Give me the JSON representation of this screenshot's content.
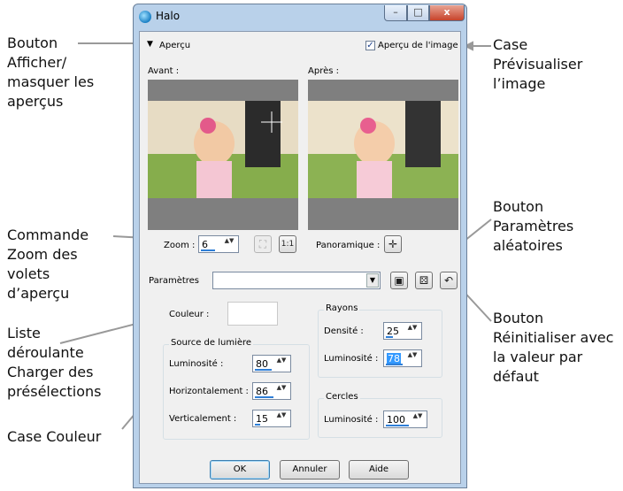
{
  "window": {
    "title": "Halo",
    "minimize": "–",
    "maximize": "□",
    "close": "x"
  },
  "preview_header": {
    "toggle_arrow": "▼",
    "label": "Aperçu",
    "preview_image_label": "Aperçu de l'image",
    "preview_image_checked": true
  },
  "panes": {
    "before_label": "Avant :",
    "after_label": "Après :"
  },
  "zoom": {
    "label": "Zoom :",
    "value": "6",
    "pan_label": "Panoramique :"
  },
  "settings": {
    "label": "Paramètres",
    "preset_value": ""
  },
  "color": {
    "label": "Couleur :"
  },
  "light_source": {
    "title": "Source de lumière",
    "brightness_label": "Luminosité :",
    "brightness_value": "80",
    "horizontal_label": "Horizontalement :",
    "horizontal_value": "86",
    "vertical_label": "Verticalement :",
    "vertical_value": "15"
  },
  "rays": {
    "title": "Rayons",
    "density_label": "Densité :",
    "density_value": "25",
    "brightness_label": "Luminosité :",
    "brightness_value": "78"
  },
  "circles": {
    "title": "Cercles",
    "brightness_label": "Luminosité :",
    "brightness_value": "100"
  },
  "buttons": {
    "ok": "OK",
    "cancel": "Annuler",
    "help": "Aide"
  },
  "annotations": {
    "toggle_preview": [
      "Bouton",
      "Afficher/",
      "masquer les",
      "aperçus"
    ],
    "preview_image": [
      "Case",
      "Prévisualiser",
      "l’image"
    ],
    "zoom": [
      "Commande",
      "Zoom des",
      "volets",
      "d’aperçu"
    ],
    "preset_list": [
      "Liste",
      "déroulante",
      "Charger des",
      "présélections"
    ],
    "color_box": [
      "Case Couleur"
    ],
    "random": [
      "Bouton",
      "Paramètres",
      "aléatoires"
    ],
    "reset": [
      "Bouton",
      "Réinitialiser avec",
      "la valeur par",
      "défaut"
    ]
  },
  "colors": {
    "accent": "#2f7fd7",
    "window_frame": "#b9d1ea",
    "dialog_bg": "#f0f0f0",
    "callout_line": "#999999"
  },
  "icons": {
    "app": "halo-app-icon",
    "save": "save-preset-icon",
    "random": "dice-icon",
    "reset": "reset-icon",
    "pan": "move-cross-icon"
  }
}
